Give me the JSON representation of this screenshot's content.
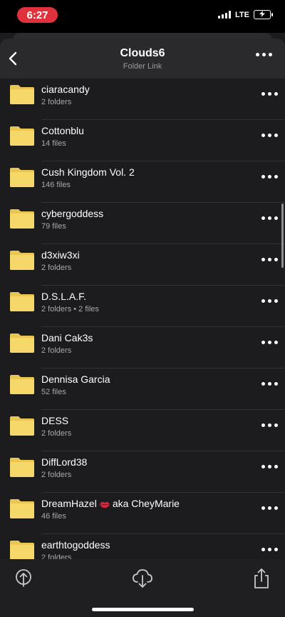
{
  "status_bar": {
    "time": "6:27",
    "network": "LTE",
    "time_color": "#e0323c"
  },
  "header": {
    "title": "Clouds6",
    "subtitle": "Folder Link"
  },
  "folders": [
    {
      "name": "ciaracandy",
      "meta": "2 folders"
    },
    {
      "name": "Cottonblu",
      "meta": "14 files"
    },
    {
      "name": "Cush Kingdom Vol. 2",
      "meta": "146 files"
    },
    {
      "name": "cybergoddess",
      "meta": "79 files"
    },
    {
      "name": "d3xiw3xi",
      "meta": "2 folders"
    },
    {
      "name": "D.S.L.A.F.",
      "meta": "2 folders • 2 files"
    },
    {
      "name": "Dani Cak3s",
      "meta": "2 folders"
    },
    {
      "name": "Dennisa Garcia",
      "meta": "52 files"
    },
    {
      "name": "DESS",
      "meta": "2 folders"
    },
    {
      "name": "DiffLord38",
      "meta": "2 folders"
    },
    {
      "name_prefix": "DreamHazel",
      "name_suffix": "aka CheyMarie",
      "emoji_icon": "lips-emoji",
      "meta": "46 files"
    },
    {
      "name": "earthtogoddess",
      "meta": "2 folders"
    }
  ],
  "toolbar": {
    "icons": [
      "upload-icon",
      "cloud-download-icon",
      "share-icon"
    ]
  },
  "colors": {
    "folder": "#f6d86a",
    "folder_dark": "#e9c652",
    "background": "#1c1c1e",
    "header": "#2a2a2c"
  }
}
